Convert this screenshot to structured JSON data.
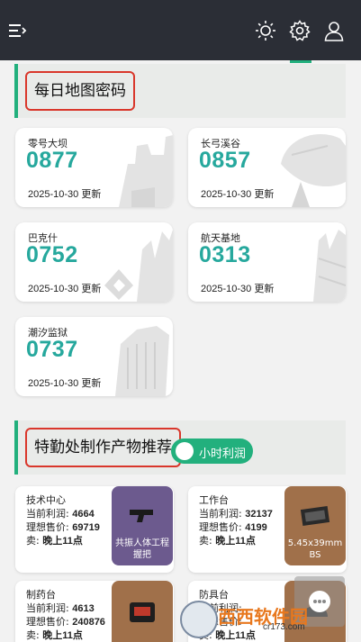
{
  "header": {
    "icons": [
      "menu-icon",
      "sun-icon",
      "gear-icon",
      "user-icon"
    ],
    "background": "#2b2e36"
  },
  "map_codes": {
    "title": "每日地图密码",
    "cards": [
      {
        "name": "零号大坝",
        "code": "0877",
        "date": "2025-10-30 更新"
      },
      {
        "name": "长弓溪谷",
        "code": "0857",
        "date": "2025-10-30 更新"
      },
      {
        "name": "巴克什",
        "code": "0752",
        "date": "2025-10-30 更新"
      },
      {
        "name": "航天基地",
        "code": "0313",
        "date": "2025-10-30 更新"
      },
      {
        "name": "潮汐监狱",
        "code": "0737",
        "date": "2025-10-30 更新"
      }
    ]
  },
  "production": {
    "title": "特勤处制作产物推荐",
    "toggle_label": "小时利润",
    "toggle_on": true,
    "labels": {
      "profit": "当前利润:",
      "price": "理想售价:",
      "sell": "卖:"
    },
    "cards": [
      {
        "station": "技术中心",
        "profit": "4664",
        "price": "69719",
        "sell": "晚上11点",
        "item": "共振人体工程握把",
        "item_color": "#6c5a8e"
      },
      {
        "station": "工作台",
        "profit": "32137",
        "price": "4199",
        "sell": "晚上11点",
        "item": "5.45x39mm BS",
        "item_color": "#a0704a"
      },
      {
        "station": "制药台",
        "profit": "4613",
        "price": "240876",
        "sell": "晚上11点",
        "item": "",
        "item_color": "#a0704a"
      },
      {
        "station": "防具台",
        "profit": "",
        "price": "",
        "sell": "晚上11点",
        "item": "",
        "item_color": "#a0704a"
      }
    ]
  },
  "watermark": {
    "main": "西西软件园",
    "sub": "cr173.com"
  },
  "colors": {
    "accent": "#22b07d",
    "code": "#26a89d",
    "highlight_box": "#d9372b"
  }
}
